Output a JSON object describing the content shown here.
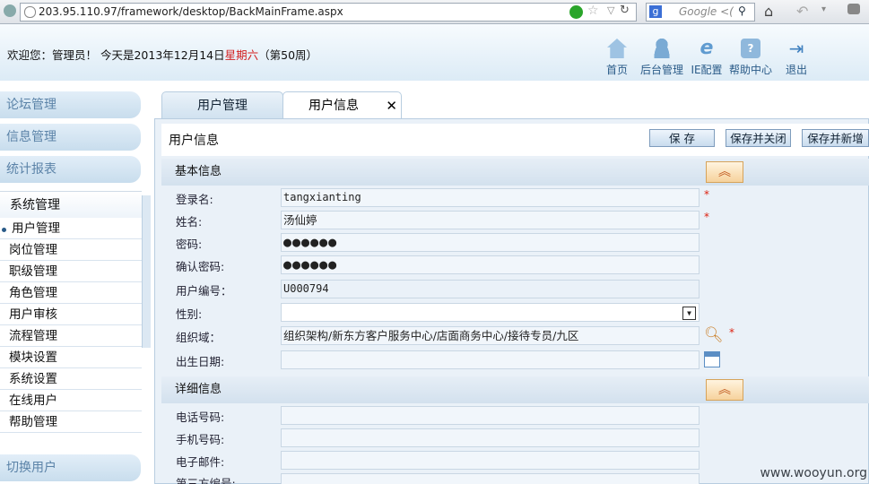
{
  "browser": {
    "url": "203.95.110.97/framework/desktop/BackMainFrame.aspx",
    "search_placeholder": "Google <("
  },
  "header": {
    "welcome": "欢迎您：管理员！  今天是2013年12月14日",
    "weekday": "星期六",
    "week": "（第50周）",
    "nav": [
      "首页",
      "后台管理",
      "IE配置",
      "帮助中心",
      "退出"
    ]
  },
  "sidebar": {
    "categories": [
      "论坛管理",
      "信息管理",
      "统计报表"
    ],
    "active_category": "系统管理",
    "items": [
      "用户管理",
      "岗位管理",
      "职级管理",
      "角色管理",
      "用户审核",
      "流程管理",
      "模块设置",
      "系统设置",
      "在线用户",
      "帮助管理"
    ],
    "switch_label": "切换用户"
  },
  "tabs": [
    {
      "label": "用户管理"
    },
    {
      "label": "用户信息",
      "close": "✕"
    }
  ],
  "panel": {
    "title": "用户信息",
    "buttons": [
      "保 存",
      "保存并关闭",
      "保存并新增"
    ]
  },
  "sections": {
    "basic": "基本信息",
    "detail": "详细信息"
  },
  "fields": {
    "login_label": "登录名:",
    "login_value": "tangxianting",
    "name_label": "姓名:",
    "name_value": "汤仙婷",
    "pwd_label": "密码:",
    "pwd_value": "●●●●●●",
    "pwd2_label": "确认密码:",
    "pwd2_value": "●●●●●●",
    "userno_label": "用户编号：",
    "userno_value": "U000794",
    "gender_label": "性别:",
    "org_label": "组织域：",
    "org_value": "组织架构/新东方客户服务中心/店面商务中心/接待专员/九区",
    "birth_label": "出生日期:",
    "phone_label": "电话号码:",
    "mobile_label": "手机号码:",
    "email_label": "电子邮件:",
    "third_label": "第三方编号:"
  },
  "required_mark": "*",
  "watermark": "www.wooyun.org",
  "colors": {
    "accent": "#2a5b88",
    "weekday": "#d21f1f",
    "required": "#dd2211"
  }
}
